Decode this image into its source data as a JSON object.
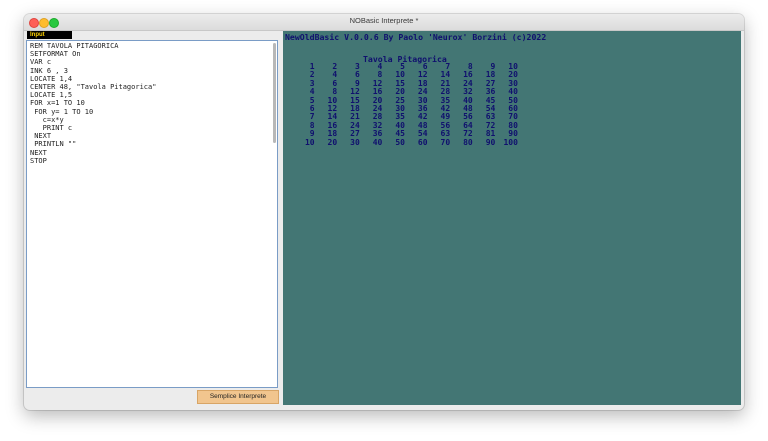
{
  "window": {
    "title": "NOBasic Interprete *"
  },
  "editor": {
    "tab_label": "Input",
    "lines": [
      "REM TAVOLA PITAGORICA",
      "SETFORMAT On",
      "VAR c",
      "INK 6 , 3",
      "LOCATE 1,4",
      "CENTER 48, \"Tavola Pitagorica\"",
      "LOCATE 1,5",
      "FOR x=1 TO 10",
      " FOR y= 1 TO 10",
      "   c=x*y",
      "   PRINT c",
      " NEXT",
      " PRINTLN \"\"",
      "NEXT",
      "STOP"
    ],
    "run_button_label": "Semplice Interprete"
  },
  "output": {
    "header": "NewOldBasic V.0.0.6 By Paolo 'Neurox' Borzini (c)2022",
    "table_title": "Tavola Pitagorica",
    "table": [
      [
        1,
        2,
        3,
        4,
        5,
        6,
        7,
        8,
        9,
        10
      ],
      [
        2,
        4,
        6,
        8,
        10,
        12,
        14,
        16,
        18,
        20
      ],
      [
        3,
        6,
        9,
        12,
        15,
        18,
        21,
        24,
        27,
        30
      ],
      [
        4,
        8,
        12,
        16,
        20,
        24,
        28,
        32,
        36,
        40
      ],
      [
        5,
        10,
        15,
        20,
        25,
        30,
        35,
        40,
        45,
        50
      ],
      [
        6,
        12,
        18,
        24,
        30,
        36,
        42,
        48,
        54,
        60
      ],
      [
        7,
        14,
        21,
        28,
        35,
        42,
        49,
        56,
        63,
        70
      ],
      [
        8,
        16,
        24,
        32,
        40,
        48,
        56,
        64,
        72,
        80
      ],
      [
        9,
        18,
        27,
        36,
        45,
        54,
        63,
        72,
        81,
        90
      ],
      [
        10,
        20,
        30,
        40,
        50,
        60,
        70,
        80,
        90,
        100
      ]
    ],
    "background_color": "#437674",
    "text_color": "#10106e"
  }
}
